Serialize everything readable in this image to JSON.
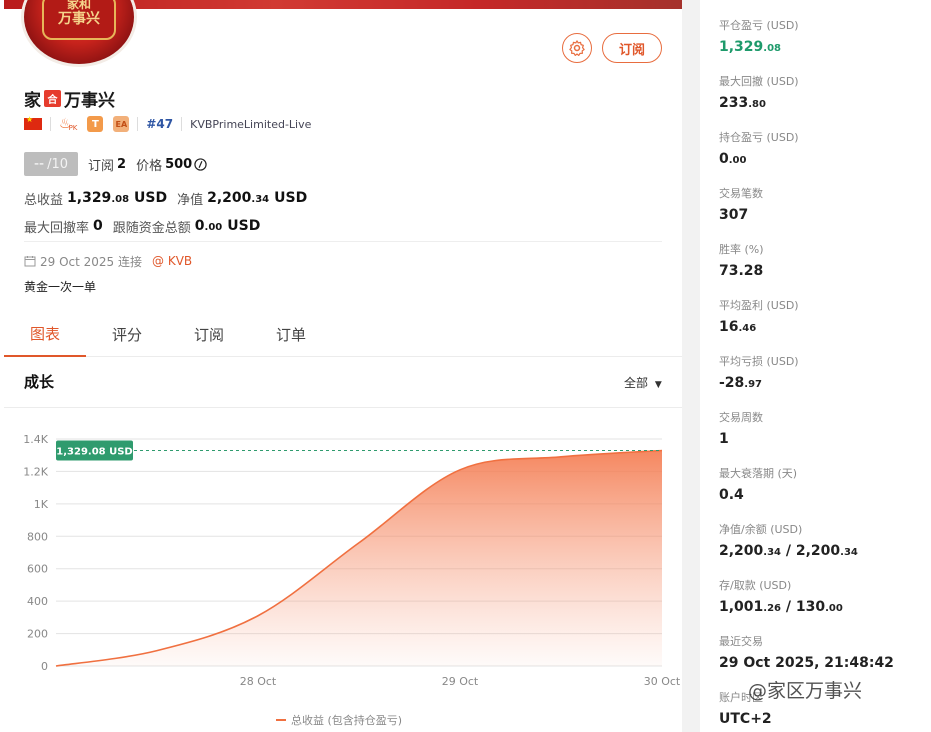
{
  "avatar": {
    "line1": "家和",
    "line2": "万事兴"
  },
  "header": {
    "name_pre": "家",
    "name_badge": "合",
    "name_post": "万事兴",
    "subscribe_label": "订阅"
  },
  "badges": {
    "pk": "PK",
    "t": "T",
    "ea": "EA",
    "rank": "#47",
    "broker": "KVBPrimeLimited-Live"
  },
  "rating": {
    "score": "--",
    "denominator": "/10",
    "subs_label": "订阅",
    "subs_value": "2",
    "price_label": "价格",
    "price_value": "500"
  },
  "stats": {
    "total_profit_label": "总收益",
    "total_profit_main": "1,329",
    "total_profit_dec": ".08",
    "total_profit_unit": "USD",
    "equity_label": "净值",
    "equity_main": "2,200",
    "equity_dec": ".34",
    "equity_unit": "USD",
    "max_dd_label": "最大回撤率",
    "max_dd_value": "0",
    "follow_label": "跟随资金总额",
    "follow_main": "0",
    "follow_dec": ".00",
    "follow_unit": "USD"
  },
  "meta": {
    "date_text": "29 Oct 2025 连接",
    "broker_link": "@ KVB",
    "description": "黄金一次一单"
  },
  "tabs": [
    "图表",
    "评分",
    "订阅",
    "订单"
  ],
  "chart_section": {
    "title": "成长",
    "range_label": "全部"
  },
  "chart_data": {
    "type": "area",
    "x": [
      "27 Oct",
      "27 Oct 12:00",
      "28 Oct",
      "28 Oct 12:00",
      "29 Oct",
      "29 Oct 12:00",
      "30 Oct"
    ],
    "series": [
      {
        "name": "总收益 (包含持仓盈亏)",
        "values": [
          0,
          95,
          310,
          760,
          1210,
          1290,
          1329.08
        ]
      }
    ],
    "x_tick_labels": [
      "28 Oct",
      "29 Oct",
      "30 Oct"
    ],
    "y_ticks": [
      0,
      200,
      400,
      600,
      800,
      1000,
      1200,
      1400
    ],
    "y_tick_labels": [
      "0",
      "200",
      "400",
      "600",
      "800",
      "1K",
      "1.2K",
      "1.4K"
    ],
    "ylim": [
      0,
      1400
    ],
    "current_value_label": "1,329.08 USD",
    "current_value": 1329.08,
    "grid": true,
    "legend_position": "bottom",
    "colors": {
      "line": "#f07040",
      "fill": "#f58a5e",
      "marker": "#2f9b6e"
    }
  },
  "metrics": [
    {
      "label": "平仓盈亏 (USD)",
      "main": "1,329",
      "dec": ".08",
      "color": "green"
    },
    {
      "label": "最大回撤 (USD)",
      "main": "233",
      "dec": ".80"
    },
    {
      "label": "持仓盈亏 (USD)",
      "main": "0",
      "dec": ".00"
    },
    {
      "label": "交易笔数",
      "main": "307",
      "dec": ""
    },
    {
      "label": "胜率 (%)",
      "main": "73.28",
      "dec": ""
    },
    {
      "label": "平均盈利 (USD)",
      "main": "16",
      "dec": ".46"
    },
    {
      "label": "平均亏损 (USD)",
      "main": "-28",
      "dec": ".97"
    },
    {
      "label": "交易周数",
      "main": "1",
      "dec": ""
    },
    {
      "label": "最大衰落期 (天)",
      "main": "0.4",
      "dec": ""
    },
    {
      "label": "净值/余额 (USD)",
      "main": "2,200",
      "dec": ".34",
      "main2": " / 2,200",
      "dec2": ".34"
    },
    {
      "label": "存/取款 (USD)",
      "main": "1,001",
      "dec": ".26",
      "main2": " / 130",
      "dec2": ".00"
    },
    {
      "label": "最近交易",
      "main": "29 Oct 2025, 21:48:42",
      "dec": ""
    },
    {
      "label": "账户时区",
      "main": "UTC+2",
      "dec": ""
    }
  ],
  "watermark": "@家区万事兴"
}
